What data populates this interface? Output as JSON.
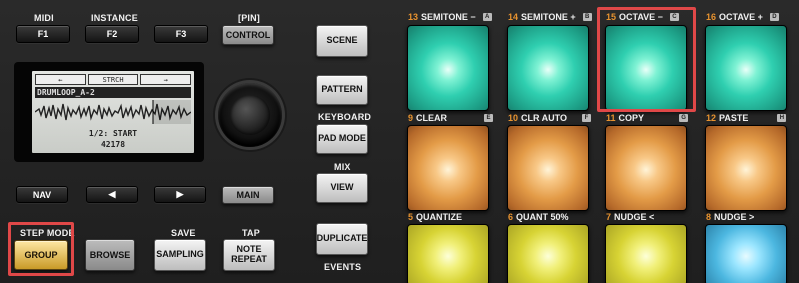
{
  "top_labels": {
    "midi": "MIDI",
    "instance": "INSTANCE",
    "pin": "[PIN]",
    "keyboard": "KEYBOARD",
    "mix": "MIX",
    "step_mode": "STEP MODE",
    "save": "SAVE",
    "tap": "TAP",
    "events": "EVENTS"
  },
  "buttons": {
    "f1": "F1",
    "f2": "F2",
    "f3": "F3",
    "control": "CONTROL",
    "nav": "NAV",
    "prev": "◀",
    "next": "▶",
    "main": "MAIN",
    "group": "GROUP",
    "browse": "BROWSE",
    "sampling": "SAMPLING",
    "note_repeat": "NOTE REPEAT",
    "scene": "SCENE",
    "pattern": "PATTERN",
    "pad_mode": "PAD MODE",
    "view": "VIEW",
    "duplicate": "DUPLICATE"
  },
  "screen": {
    "tab_left": "←",
    "tab_mid": "STRCH",
    "tab_right": "→",
    "sample_name": "DRUMLOOP_A-2",
    "line1": "1/2: START",
    "line2": "42178"
  },
  "pads": {
    "row1": [
      {
        "num": "13",
        "label": "SEMITONE −",
        "tag": "A"
      },
      {
        "num": "14",
        "label": "SEMITONE +",
        "tag": "B"
      },
      {
        "num": "15",
        "label": "OCTAVE −",
        "tag": "C"
      },
      {
        "num": "16",
        "label": "OCTAVE +",
        "tag": "D"
      }
    ],
    "row2": [
      {
        "num": "9",
        "label": "CLEAR",
        "tag": "E"
      },
      {
        "num": "10",
        "label": "CLR AUTO",
        "tag": "F"
      },
      {
        "num": "11",
        "label": "COPY",
        "tag": "G"
      },
      {
        "num": "12",
        "label": "PASTE",
        "tag": "H"
      }
    ],
    "row3": [
      {
        "num": "5",
        "label": "QUANTIZE",
        "tag": ""
      },
      {
        "num": "6",
        "label": "QUANT 50%",
        "tag": ""
      },
      {
        "num": "7",
        "label": "NUDGE <",
        "tag": ""
      },
      {
        "num": "8",
        "label": "NUDGE >",
        "tag": ""
      }
    ]
  },
  "colors": {
    "highlight": "#e04848",
    "pad_cyan": "#2fcfb0",
    "pad_orange": "#e39b47",
    "pad_yellow": "#d7d334",
    "pad_blue": "#4cb7e0",
    "pad_number": "#e8932f"
  }
}
